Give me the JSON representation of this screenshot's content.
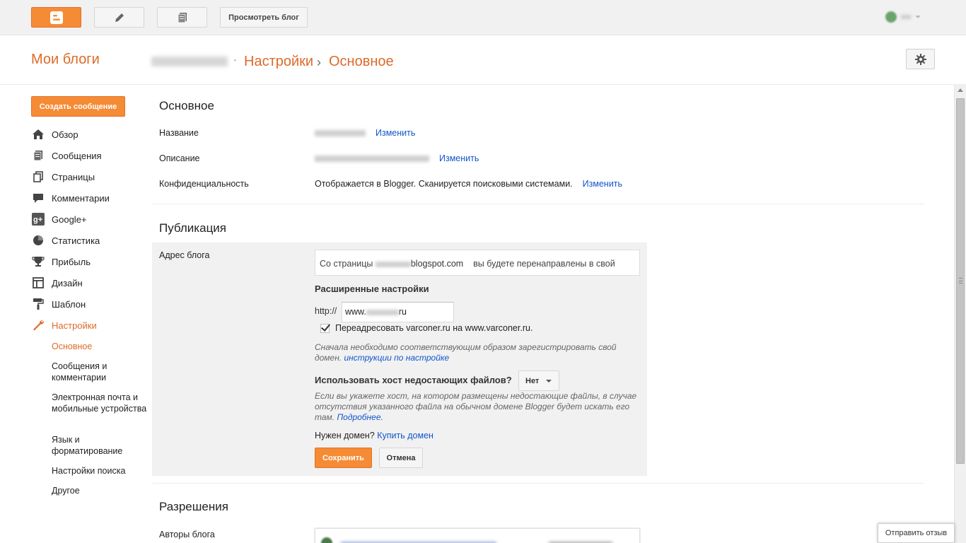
{
  "topbar": {
    "view_blog_label": "Просмотреть блог"
  },
  "header": {
    "my_blogs": "Мои блоги",
    "crumb_dot": "·",
    "crumb_settings": "Настройки",
    "crumb_sep": "›",
    "crumb_current": "Основное"
  },
  "sidebar": {
    "create_post": "Создать сообщение",
    "items": [
      {
        "label": "Обзор",
        "icon": "home-icon"
      },
      {
        "label": "Сообщения",
        "icon": "posts-icon"
      },
      {
        "label": "Страницы",
        "icon": "pages-icon"
      },
      {
        "label": "Комментарии",
        "icon": "comment-icon"
      },
      {
        "label": "Google+",
        "icon": "google-plus-icon"
      },
      {
        "label": "Статистика",
        "icon": "pie-chart-icon"
      },
      {
        "label": "Прибыль",
        "icon": "trophy-icon"
      },
      {
        "label": "Дизайн",
        "icon": "layout-icon"
      },
      {
        "label": "Шаблон",
        "icon": "paint-roller-icon"
      },
      {
        "label": "Настройки",
        "icon": "wrench-icon"
      }
    ],
    "subitems": [
      "Основное",
      "Сообщения и комментарии",
      "Электронная почта и мобильные устройства",
      "Язык и форматирование",
      "Настройки поиска",
      "Другое"
    ]
  },
  "basic": {
    "title": "Основное",
    "name_label": "Название",
    "change": "Изменить",
    "desc_label": "Описание",
    "privacy_label": "Конфиденциальность",
    "privacy_value": "Отображается в Blogger. Сканируется поисковыми системами."
  },
  "publishing": {
    "title": "Публикация",
    "address_label": "Адрес блога",
    "redirect_prefix": "Со страницы",
    "redirect_domain": "blogspot.com",
    "redirect_suffix": "вы будете перенаправлены в свой домен.",
    "advanced_title": "Расширенные настройки",
    "http_label": "http://",
    "domain_prefix": "www.",
    "domain_suffix": "ru",
    "checkbox_label": "Переадресовать varconer.ru на www.varconer.ru.",
    "hint1": "Сначала необходимо соответствующим образом зарегистрировать свой домен.",
    "hint1_link": "инструкции по настройке",
    "missing_files_question": "Использовать хост недостающих файлов?",
    "missing_files_value": "Нет",
    "hint2": "Если вы укажете хост, на котором размещены недостающие файлы, в случае отсутствия указанного файла на обычном домене Blogger будет искать его там.",
    "hint2_link": "Подробнее.",
    "need_domain": "Нужен домен?",
    "buy_domain": "Купить домен",
    "save": "Сохранить",
    "cancel": "Отмена"
  },
  "permissions": {
    "title": "Разрешения",
    "authors_label": "Авторы блога"
  },
  "feedback": "Отправить отзыв",
  "colors": {
    "accent": "#dd6a29",
    "button_orange": "#f68b35",
    "link": "#1155cc"
  }
}
